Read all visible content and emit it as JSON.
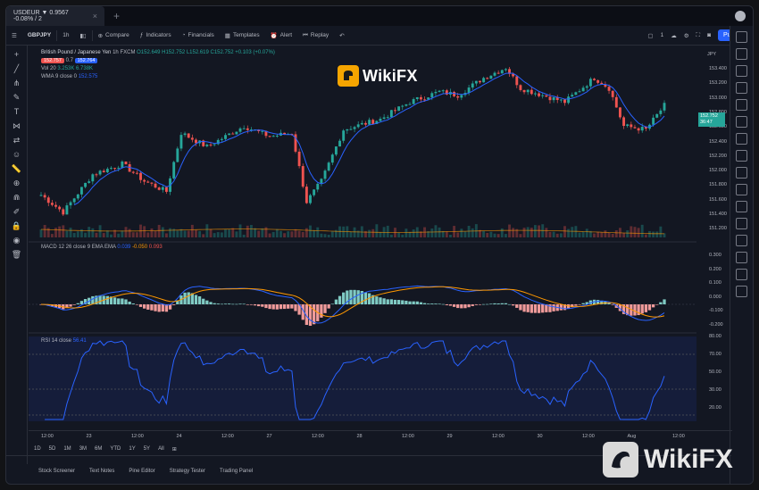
{
  "tabbar": {
    "tab_label": "USDEUR ▼ 0.9567 -0.08% / 2",
    "close": "×",
    "add": "+"
  },
  "toolbar": {
    "symbol": "GBPJPY",
    "interval": "1h",
    "compare": "Compare",
    "indicators": "Indicators",
    "financials": "Financials",
    "templates": "Templates",
    "alert": "Alert",
    "replay": "Replay",
    "layout": "1",
    "publish": "Publish"
  },
  "legend": {
    "title": "British Pound / Japanese Yen",
    "interval": "1h",
    "source": "FXCM",
    "ohlc": "O152.649 H152.752 L152.619 C152.752 +0.103 (+0.07%)",
    "sell": "152.757",
    "spread": "0.7",
    "buy": "152.764",
    "vol": "Vol 20",
    "vol_values": "3.253K 6.738K",
    "wma": "WMA 9 close 0",
    "wma_value": "152.575"
  },
  "macd_legend": {
    "label": "MACD 12 26 close 9 EMA EMA",
    "v1": "0.039",
    "v2": "-0.050",
    "v3": "0.093"
  },
  "rsi_legend": {
    "label": "RSI 14 close",
    "value": "56.41"
  },
  "price_scale": {
    "main": [
      "153.400",
      "153.200",
      "153.000",
      "152.800",
      "152.600",
      "152.400",
      "152.200",
      "152.000",
      "151.800",
      "151.600",
      "151.400",
      "151.200"
    ],
    "current_price": "152.752",
    "current_countdown": "36:47",
    "jpy": "JPY",
    "macd": [
      "0.300",
      "0.200",
      "0.100",
      "0.000",
      "-0.100",
      "-0.200"
    ],
    "rsi": [
      "80.00",
      "70.00",
      "50.00",
      "30.00",
      "20.00"
    ]
  },
  "time_axis": [
    "12:00",
    "23",
    "12:00",
    "24",
    "12:00",
    "27",
    "12:00",
    "28",
    "12:00",
    "29",
    "12:00",
    "30",
    "12:00",
    "Aug",
    "12:00"
  ],
  "ranges": [
    "1D",
    "5D",
    "1M",
    "3M",
    "6M",
    "YTD",
    "1Y",
    "5Y",
    "All"
  ],
  "bottom_tabs": [
    "Stock Screener",
    "Text Notes",
    "Pine Editor",
    "Strategy Tester",
    "Trading Panel"
  ],
  "watermark": "WikiFX",
  "colors": {
    "up": "#26a69a",
    "down": "#ef5350",
    "wma": "#2962ff",
    "macd_signal": "#ff9800",
    "rsi": "#2962ff",
    "bg": "#131722"
  }
}
